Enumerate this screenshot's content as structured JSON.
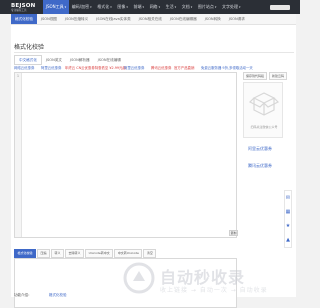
{
  "brand": {
    "name": "BEJSON",
    "tagline": "专注编程工具"
  },
  "nav": {
    "items": [
      {
        "label": "JSON工具",
        "active": true
      },
      {
        "label": "编码/加密"
      },
      {
        "label": "格式化"
      },
      {
        "label": "图像"
      },
      {
        "label": "前端"
      },
      {
        "label": "网络"
      },
      {
        "label": "生活"
      },
      {
        "label": "文档"
      },
      {
        "label": "图片站点"
      },
      {
        "label": "文字处理"
      }
    ]
  },
  "tabs_top": [
    {
      "label": "格式化校验",
      "active": true
    },
    {
      "label": "JSON视图"
    },
    {
      "label": "JSON压缩转义"
    },
    {
      "label": "JSON在线Java实体类"
    },
    {
      "label": "JSON相关在线"
    },
    {
      "label": "JSON在线编辑器"
    },
    {
      "label": "JSON转换"
    },
    {
      "label": "JSON请求"
    }
  ],
  "page_title": "格式化校验",
  "tabs_mode": [
    {
      "label": "中文格式化",
      "active": true
    },
    {
      "label": "JSON英文"
    },
    {
      "label": "JSON解析器"
    },
    {
      "label": "JSON在线编辑"
    }
  ],
  "notes": [
    {
      "text": "网络云优惠券",
      "color": "#3f69c8"
    },
    {
      "text": "阿里云优惠券",
      "color": "#3f69c8"
    },
    {
      "text": "年终云 CN云优惠券特惠低至 ¥2.99元起",
      "color": "#d93b3b"
    },
    {
      "text": "阿里云优惠券",
      "color": "#3f69c8"
    },
    {
      "text": "腾讯云优惠券",
      "color": "#d93b3b"
    },
    {
      "text": "官方产品直销",
      "color": "#d93b3b"
    },
    {
      "text": "免费云服务器 9折,多领取活动一天",
      "color": "#3f69c8"
    }
  ],
  "editor": {
    "line_number": "1",
    "copy_label": "复制"
  },
  "side_buttons": [
    "保存到代码段",
    "新建云码"
  ],
  "qr_caption": "扫码关注微信公众号",
  "quick_links": [
    "阿里云优惠券",
    "腾讯云优惠券"
  ],
  "toolbar": [
    {
      "label": "格式化校验",
      "active": true
    },
    {
      "label": "压缩"
    },
    {
      "label": "转义"
    },
    {
      "label": "去除转义"
    },
    {
      "label": "Unicode转中文"
    },
    {
      "label": "中文转Unicode"
    },
    {
      "label": "清空"
    }
  ],
  "footer": {
    "label": "功能介绍：",
    "link": "格式化校验"
  },
  "watermark": {
    "text": "自动秒收录",
    "sub": "收上链接 → 自动一次 → 自动收录"
  },
  "colors": {
    "accent": "#3f69c8",
    "topbar": "#2b2f36",
    "danger": "#d93b3b"
  }
}
